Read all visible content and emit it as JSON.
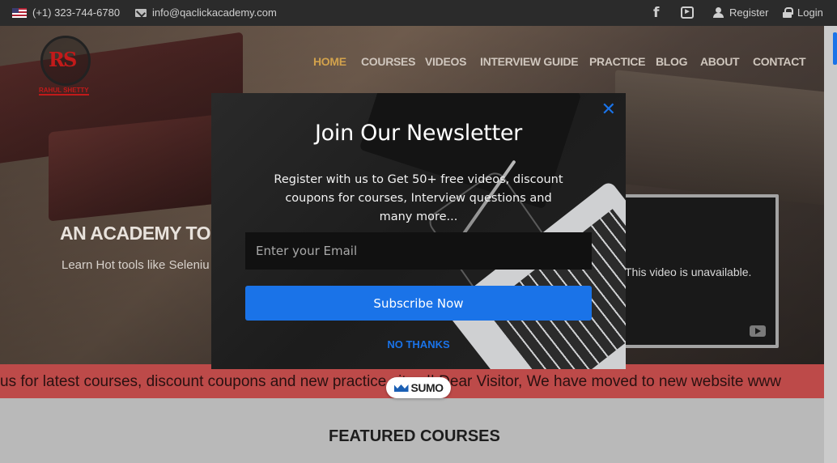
{
  "topbar": {
    "phone": "(+1) 323-744-6780",
    "email": "info@qaclickacademy.com",
    "register": "Register",
    "login": "Login"
  },
  "logo": {
    "monogram": "RS",
    "name": "RAHUL SHETTY"
  },
  "nav": {
    "items": [
      "HOME",
      "COURSES",
      "VIDEOS",
      "INTERVIEW GUIDE",
      "PRACTICE",
      "BLOG",
      "ABOUT",
      "CONTACT"
    ],
    "active": "HOME"
  },
  "hero": {
    "heading": "AN ACADEMY TO",
    "subtext": "Learn Hot tools like Seleniu"
  },
  "video": {
    "message": "This video is unavailable."
  },
  "ticker": {
    "text": "us for latest courses, discount coupons and new practice sites || Dear Visitor, We have moved to new website www"
  },
  "main": {
    "featured_title": "FEATURED COURSES"
  },
  "popup": {
    "title": "Join Our Newsletter",
    "description": "Register with us to Get 50+ free videos, discount coupons for courses, Interview questions and many more...",
    "email_placeholder": "Enter your Email",
    "subscribe_label": "Subscribe Now",
    "no_thanks_label": "NO THANKS",
    "close_symbol": "✕"
  },
  "sumo": {
    "label": "SUMO"
  },
  "colors": {
    "accent": "#1a73e8",
    "nav_active": "#d2a24c",
    "ticker_bg": "#bd4a49",
    "topbar_bg": "#2b2b2b"
  }
}
